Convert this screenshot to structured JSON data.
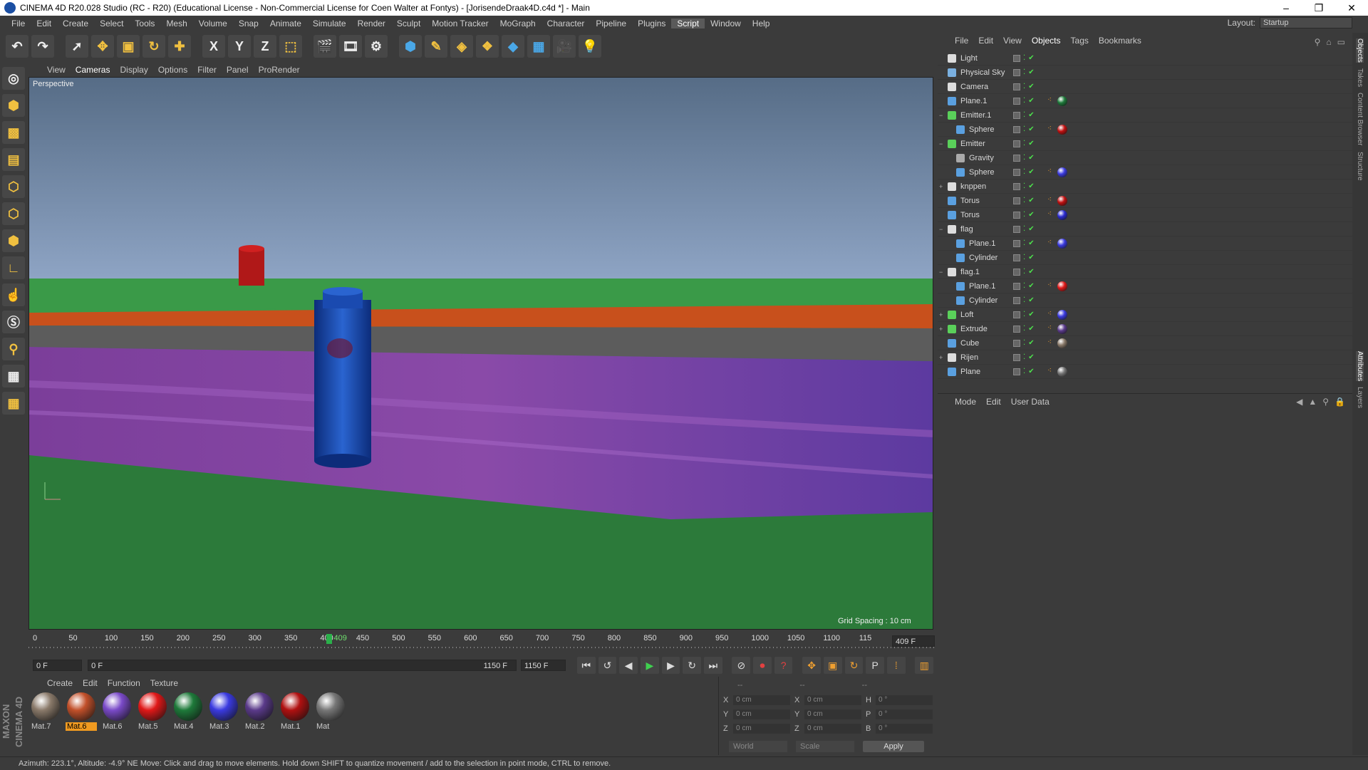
{
  "window": {
    "title": "CINEMA 4D R20.028 Studio (RC - R20) (Educational License - Non-Commercial License for Coen  Walter at Fontys) - [JorisendeDraak4D.c4d *] - Main",
    "controls": [
      "–",
      "❐",
      "✕"
    ]
  },
  "menubar": {
    "items": [
      "File",
      "Edit",
      "Create",
      "Select",
      "Tools",
      "Mesh",
      "Volume",
      "Snap",
      "Animate",
      "Simulate",
      "Render",
      "Sculpt",
      "Motion Tracker",
      "MoGraph",
      "Character",
      "Pipeline",
      "Plugins",
      "Script",
      "Window",
      "Help"
    ],
    "highlighted": "Script",
    "layout_label": "Layout:",
    "layout_value": "Startup"
  },
  "toolbar": {
    "undo": "↶",
    "redo": "↷",
    "axis_x": "X",
    "axis_y": "Y",
    "axis_z": "Z"
  },
  "viewport": {
    "menu": [
      "View",
      "Cameras",
      "Display",
      "Options",
      "Filter",
      "Panel",
      "ProRender"
    ],
    "active_menu": "Cameras",
    "label": "Perspective",
    "grid_spacing": "Grid Spacing : 10 cm"
  },
  "timeline": {
    "ticks": [
      "0",
      "50",
      "100",
      "150",
      "200",
      "250",
      "300",
      "350",
      "400",
      "450",
      "500",
      "550",
      "600",
      "650",
      "700",
      "750",
      "800",
      "850",
      "900",
      "950",
      "1000",
      "1050",
      "1100",
      "115"
    ],
    "current_frame": "409",
    "current_frame_field": "409 F",
    "start_field": "0 F",
    "range_start": "0 F",
    "range_end": "1150 F",
    "end_field": "1150 F"
  },
  "materials": {
    "tabs": [
      "Create",
      "Edit",
      "Function",
      "Texture"
    ],
    "items": [
      {
        "name": "Mat.7",
        "color": "#8a7a6a"
      },
      {
        "name": "Mat.6",
        "color": "#c2502a",
        "selected": true
      },
      {
        "name": "Mat.6",
        "color": "#7a4ac8"
      },
      {
        "name": "Mat.5",
        "color": "#e01818"
      },
      {
        "name": "Mat.4",
        "color": "#1e7a3a"
      },
      {
        "name": "Mat.3",
        "color": "#3a3ae0"
      },
      {
        "name": "Mat.2",
        "color": "#5a3a8a"
      },
      {
        "name": "Mat.1",
        "color": "#b01010"
      },
      {
        "name": "Mat",
        "color": "#777777"
      }
    ],
    "logo": "MAXON CINEMA 4D"
  },
  "coords": {
    "header": [
      "--",
      "--",
      "--"
    ],
    "rows": [
      {
        "a": "X",
        "v1": "0 cm",
        "b": "X",
        "v2": "0 cm",
        "c": "H",
        "v3": "0 °"
      },
      {
        "a": "Y",
        "v1": "0 cm",
        "b": "Y",
        "v2": "0 cm",
        "c": "P",
        "v3": "0 °"
      },
      {
        "a": "Z",
        "v1": "0 cm",
        "b": "Z",
        "v2": "0 cm",
        "c": "B",
        "v3": "0 °"
      }
    ],
    "world": "World",
    "scale": "Scale",
    "apply": "Apply"
  },
  "objects": {
    "menu": [
      "File",
      "Edit",
      "View",
      "Objects",
      "Tags",
      "Bookmarks"
    ],
    "active_menu": "Objects",
    "rows": [
      {
        "name": "Light",
        "indent": 0,
        "icon": "#ddd",
        "tags": []
      },
      {
        "name": "Physical Sky",
        "indent": 0,
        "icon": "#7ab0e0",
        "tags": []
      },
      {
        "name": "Camera",
        "indent": 0,
        "icon": "#ddd",
        "tags": []
      },
      {
        "name": "Plane.1",
        "indent": 0,
        "icon": "#5aa0e0",
        "tags": [
          "#1e7a3a"
        ]
      },
      {
        "name": "Emitter.1",
        "indent": 0,
        "icon": "#5ad05a",
        "tags": [],
        "expander": "−"
      },
      {
        "name": "Sphere",
        "indent": 1,
        "icon": "#5aa0e0",
        "tags": [
          "#c01010"
        ]
      },
      {
        "name": "Emitter",
        "indent": 0,
        "icon": "#5ad05a",
        "tags": [],
        "expander": "−"
      },
      {
        "name": "Gravity",
        "indent": 1,
        "icon": "#aaa",
        "tags": []
      },
      {
        "name": "Sphere",
        "indent": 1,
        "icon": "#5aa0e0",
        "tags": [
          "#3a3ae0"
        ]
      },
      {
        "name": "knppen",
        "indent": 0,
        "icon": "#ddd",
        "tags": [],
        "expander": "+"
      },
      {
        "name": "Torus",
        "indent": 0,
        "icon": "#5aa0e0",
        "tags": [
          "#c01010"
        ]
      },
      {
        "name": "Torus",
        "indent": 0,
        "icon": "#5aa0e0",
        "tags": [
          "#2a2ad0"
        ]
      },
      {
        "name": "flag",
        "indent": 0,
        "icon": "#ddd",
        "tags": [],
        "expander": "−"
      },
      {
        "name": "Plane.1",
        "indent": 1,
        "icon": "#5aa0e0",
        "tags": [
          "#3a3ae0"
        ]
      },
      {
        "name": "Cylinder",
        "indent": 1,
        "icon": "#5aa0e0",
        "tags": []
      },
      {
        "name": "flag.1",
        "indent": 0,
        "icon": "#ddd",
        "tags": [],
        "expander": "−"
      },
      {
        "name": "Plane.1",
        "indent": 1,
        "icon": "#5aa0e0",
        "tags": [
          "#e01818"
        ]
      },
      {
        "name": "Cylinder",
        "indent": 1,
        "icon": "#5aa0e0",
        "tags": []
      },
      {
        "name": "Loft",
        "indent": 0,
        "icon": "#5ad05a",
        "tags": [
          "#3a3ae0"
        ],
        "expander": "+"
      },
      {
        "name": "Extrude",
        "indent": 0,
        "icon": "#5ad05a",
        "tags": [
          "#5a3a8a"
        ],
        "expander": "+"
      },
      {
        "name": "Cube",
        "indent": 0,
        "icon": "#5aa0e0",
        "tags": [
          "#8a7a6a"
        ]
      },
      {
        "name": "Rijen",
        "indent": 0,
        "icon": "#ddd",
        "tags": [],
        "expander": "+"
      },
      {
        "name": "Plane",
        "indent": 0,
        "icon": "#5aa0e0",
        "tags": [
          "#777777"
        ]
      }
    ]
  },
  "attributes": {
    "menu": [
      "Mode",
      "Edit",
      "User Data"
    ]
  },
  "right_tabs": [
    "Objects",
    "Takes",
    "Content Browser",
    "Structure",
    "Attributes",
    "Layers"
  ],
  "status": "Azimuth: 223.1°, Altitude: -4.9°  NE     Move: Click and drag to move elements. Hold down SHIFT to quantize movement / add to the selection in point mode, CTRL to remove."
}
